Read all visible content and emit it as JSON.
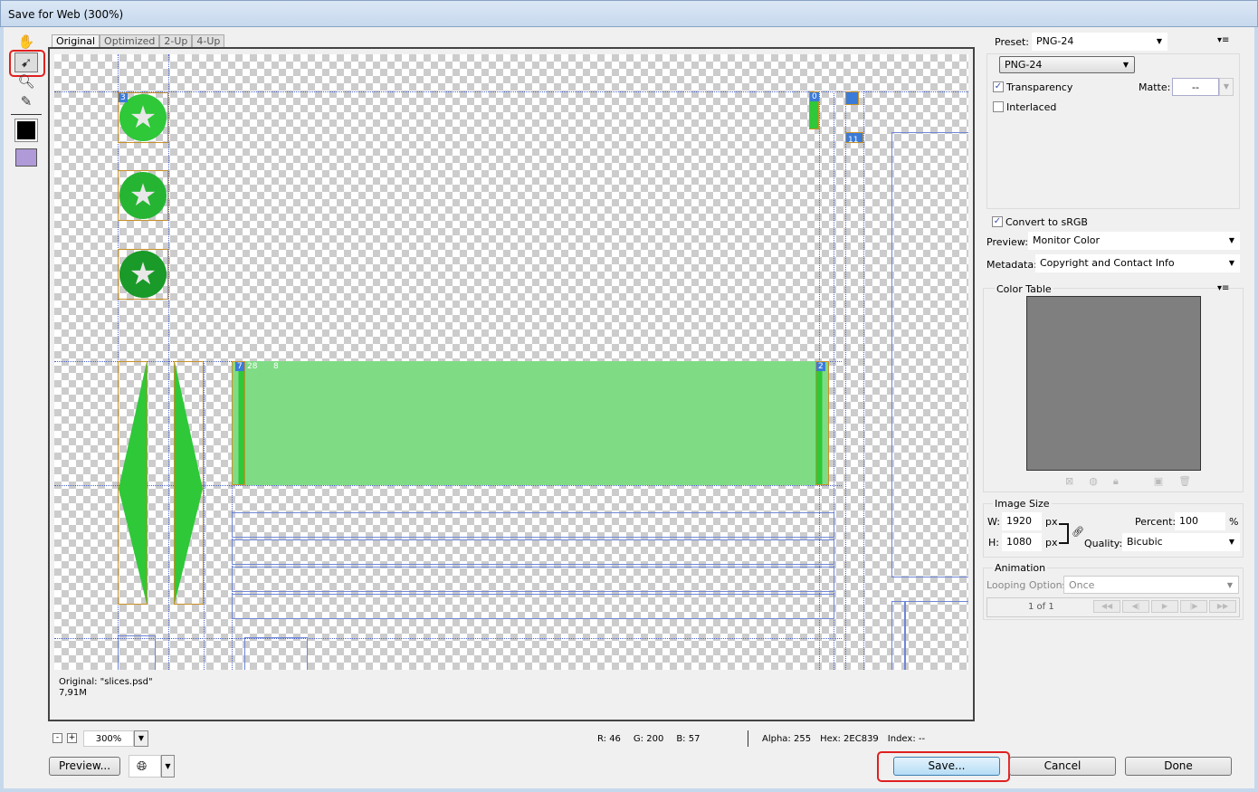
{
  "window": {
    "title": "Save for Web (300%)"
  },
  "tabs": [
    "Original",
    "Optimized",
    "2-Up",
    "4-Up"
  ],
  "slices": {
    "labels": {
      "top_icon": "3",
      "bar_right": "0",
      "right_label": "11",
      "banner_left": "7",
      "banner_num": "28",
      "banner_extra": "8",
      "banner_right": "2"
    },
    "colors": {
      "green": "#2ec839",
      "dark_green": "#1a9a28",
      "light_green": "#7fdc85",
      "slice_border": "#c8902a",
      "guide": "#4a63c8"
    }
  },
  "info": {
    "name": "Original: \"slices.psd\"",
    "size": "7,91M"
  },
  "zoom": {
    "value": "300%",
    "minus": "-",
    "plus": "+"
  },
  "readout": {
    "r": "R: 46",
    "g": "G: 200",
    "b": "B: 57",
    "alpha": "Alpha: 255",
    "hex": "Hex: 2EC839",
    "index": "Index: --"
  },
  "buttons": {
    "preview": "Preview...",
    "save": "Save...",
    "cancel": "Cancel",
    "done": "Done"
  },
  "settings": {
    "preset_label": "Preset:",
    "preset": "PNG-24",
    "format": "PNG-24",
    "transparency": {
      "label": "Transparency",
      "checked": true
    },
    "matte_label": "Matte:",
    "matte": "--",
    "interlaced": {
      "label": "Interlaced",
      "checked": false
    },
    "convert": {
      "label": "Convert to sRGB",
      "checked": true
    },
    "preview_label": "Preview:",
    "preview": "Monitor Color",
    "metadata_label": "Metadata:",
    "metadata": "Copyright and Contact Info"
  },
  "color_table": {
    "title": "Color Table"
  },
  "image_size": {
    "title": "Image Size",
    "w_label": "W:",
    "w": "1920",
    "h_label": "H:",
    "h": "1080",
    "unit": "px",
    "percent_label": "Percent:",
    "percent": "100",
    "percent_unit": "%",
    "quality_label": "Quality:",
    "quality": "Bicubic"
  },
  "animation": {
    "title": "Animation",
    "looping_label": "Looping Options:",
    "looping": "Once",
    "frame": "1 of 1"
  }
}
